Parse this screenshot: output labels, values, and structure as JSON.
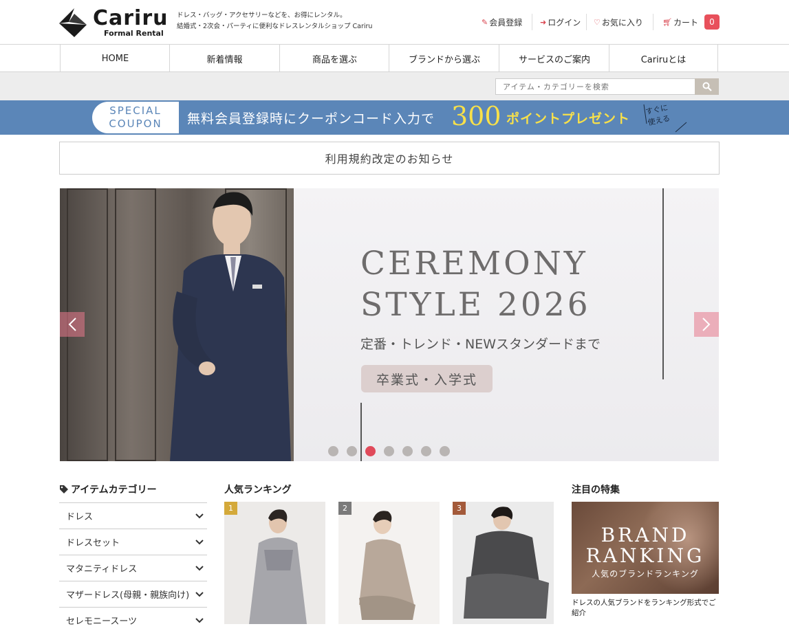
{
  "header": {
    "logo_name": "Cariru",
    "logo_sub": "Formal Rental",
    "tagline_1": "ドレス・バッグ・アクセサリーなどを、お得にレンタル。",
    "tagline_2": "結婚式・2次会・パーティに便利なドレスレンタルショップ Cariru",
    "register": "会員登録",
    "login": "ログイン",
    "favorites": "お気に入り",
    "cart": "カート",
    "cart_count": "0",
    "accent_color": "#e8505b"
  },
  "nav": {
    "items": [
      "HOME",
      "新着情報",
      "商品を選ぶ",
      "ブランドから選ぶ",
      "サービスのご案内",
      "Cariruとは"
    ]
  },
  "search": {
    "placeholder": "アイテム・カテゴリーを検索"
  },
  "coupon": {
    "pill_1": "SPECIAL",
    "pill_2": "COUPON",
    "text": "無料会員登録時にクーポンコード入力で",
    "number": "300",
    "points": "ポイントプレゼント",
    "note_1": "すぐに",
    "note_2": "使える",
    "bg_color": "#5b86b8",
    "highlight_color": "#f7e04a"
  },
  "notice": {
    "text": "利用規約改定のお知らせ"
  },
  "hero": {
    "title_1": "CEREMONY",
    "title_2": "STYLE 2026",
    "subtitle": "定番・トレンド・NEWスタンダードまで",
    "tag": "卒業式・入学式",
    "slide_count": 7,
    "active_slide": 3
  },
  "categories": {
    "title": "アイテムカテゴリー",
    "items": [
      "ドレス",
      "ドレスセット",
      "マタニティドレス",
      "マザードレス(母親・親族向け)",
      "セレモニースーツ"
    ]
  },
  "ranking": {
    "title": "人気ランキング",
    "items": [
      {
        "rank": "1",
        "badge_color": "#d4a93a"
      },
      {
        "rank": "2",
        "badge_color": "#7a7a7a"
      },
      {
        "rank": "3",
        "badge_color": "#a35a3a"
      }
    ]
  },
  "feature": {
    "title": "注目の特集",
    "banner_1": "BRAND",
    "banner_2": "RANKING",
    "banner_3": "人気のブランドランキング",
    "desc": "ドレスの人気ブランドをランキング形式でご紹介"
  }
}
